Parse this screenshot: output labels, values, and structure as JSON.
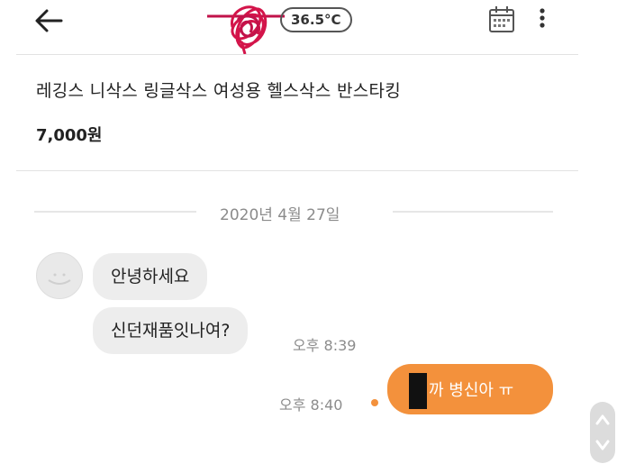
{
  "header": {
    "back_icon": "arrow-left-icon",
    "temperature": "36.5°C",
    "calendar_icon": "calendar-icon",
    "more_icon": "more-vertical-icon"
  },
  "product": {
    "title": "레깅스 니삭스 링글삭스 여성용 헬스삭스 반스타킹",
    "price": "7,000원"
  },
  "chat": {
    "date": "2020년 4월 27일",
    "messages_in": [
      {
        "text": "안녕하세요"
      },
      {
        "text": "신던재품잇나여?"
      }
    ],
    "time_in": "오후 8:39",
    "message_out": "까 병신아 ㅠ",
    "time_out": "오후 8:40"
  },
  "colors": {
    "accent": "#f3913c",
    "incoming_bubble": "#ededed",
    "scribble": "#d3144a"
  }
}
